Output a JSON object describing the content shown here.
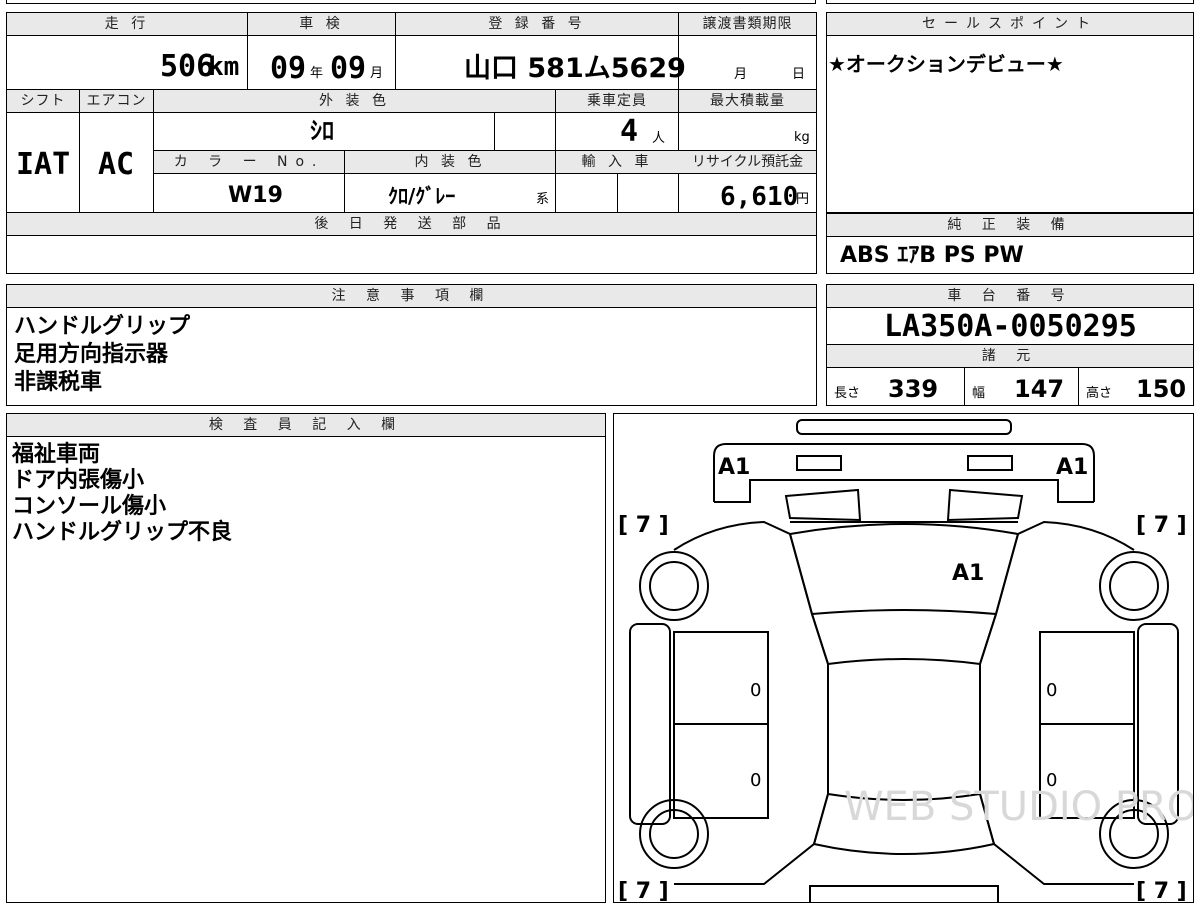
{
  "top_row": {
    "mileage": {
      "header": "走 行",
      "value": "506",
      "unit": "km"
    },
    "inspection": {
      "header": "車 検",
      "year": "09",
      "year_unit": "年",
      "month": "09",
      "month_unit": "月"
    },
    "registration": {
      "header": "登 録 番 号",
      "value": "山口 581ム5629"
    },
    "transfer_deadline": {
      "header": "譲渡書類期限",
      "month_unit": "月",
      "day_unit": "日"
    }
  },
  "second_row": {
    "shift": {
      "header": "シフト",
      "value": "IAT"
    },
    "aircon": {
      "header": "エアコン",
      "value": "AC"
    },
    "exterior_color": {
      "header": "外 装 色",
      "value": "ｼﾛ"
    },
    "capacity": {
      "header": "乗車定員",
      "value": "4",
      "unit": "人"
    },
    "max_load": {
      "header": "最大積載量",
      "unit": "kg"
    },
    "color_no": {
      "header": "カ ラ ー No.",
      "value": "W19"
    },
    "interior_color": {
      "header": "内 装 色",
      "value": "ｸﾛ/ｸﾞﾚｰ",
      "suffix": "系"
    },
    "import": {
      "header": "輸 入 車"
    },
    "recycle_fee": {
      "header": "リサイクル預託金",
      "value": "6,610",
      "unit": "円"
    }
  },
  "later_parts": {
    "header": "後 日 発 送 部 品",
    "value": ""
  },
  "sales_point": {
    "header": "セールスポイント",
    "value": "★オークションデビュー★"
  },
  "equipment": {
    "header": "純 正 装 備",
    "value": "ABS ｴｱB PS PW"
  },
  "notes": {
    "header": "注 意 事 項 欄",
    "lines": [
      "ハンドルグリップ",
      "足用方向指示器",
      "非課税車"
    ]
  },
  "chassis": {
    "header": "車 台 番 号",
    "value": "LA350A-0050295"
  },
  "specs": {
    "header": "諸 元",
    "length_label": "長さ",
    "length": "339",
    "width_label": "幅",
    "width": "147",
    "height_label": "高さ",
    "height": "150"
  },
  "inspector": {
    "header": "検 査 員 記 入 欄",
    "lines": [
      "福祉車両",
      "ドア内張傷小",
      "コンソール傷小",
      "ハンドルグリップ不良"
    ]
  },
  "diagram": {
    "labels": {
      "front_left": "A1",
      "front_right": "A1",
      "hood": "A1",
      "tire_fl": "[ 7 ]",
      "tire_fr": "[ 7 ]",
      "tire_rl": "[ 7 ]",
      "tire_rr": "[ 7 ]",
      "door_fl": "0",
      "door_fr": "0",
      "door_rl": "0",
      "door_rr": "0"
    },
    "watermark": "WEB STUDIO PRO"
  }
}
